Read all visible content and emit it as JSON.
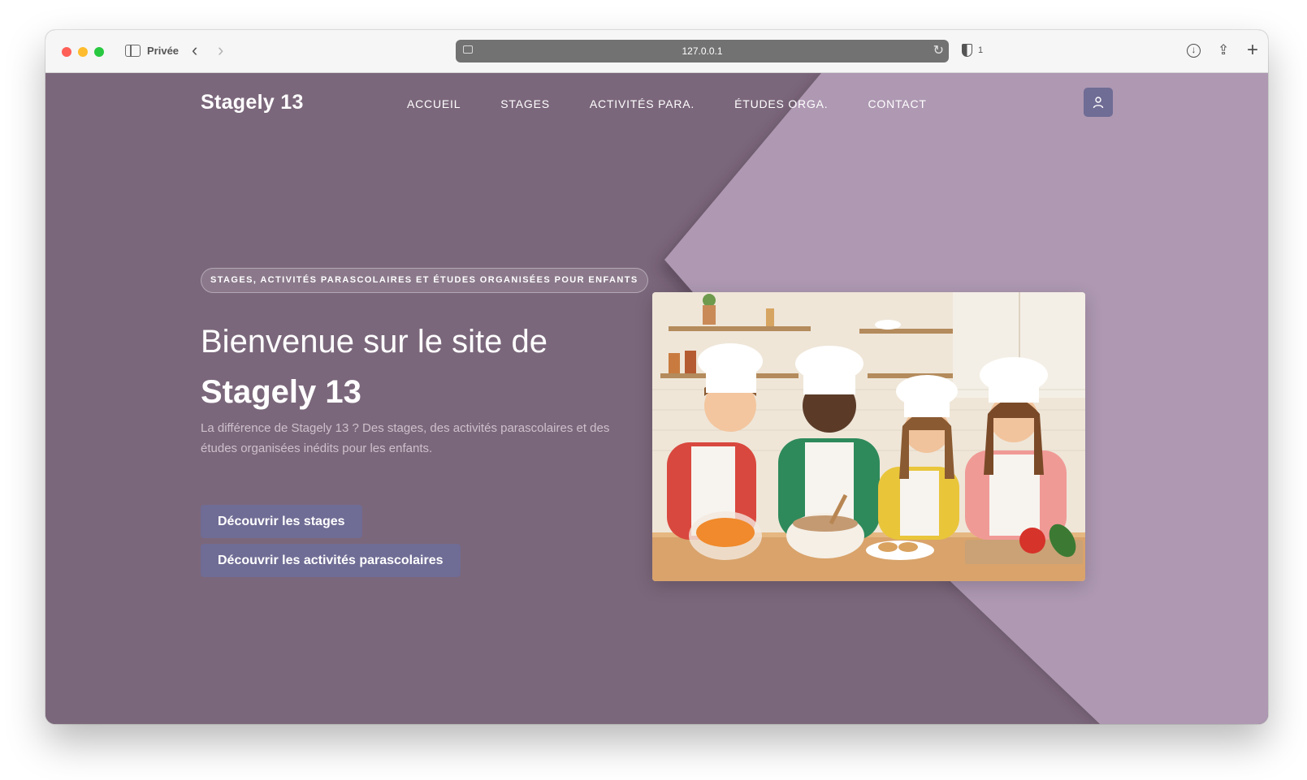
{
  "browser": {
    "private_label": "Privée",
    "url": "127.0.0.1",
    "shield_count": "1"
  },
  "site": {
    "brand": "Stagely 13",
    "nav": [
      "ACCUEIL",
      "STAGES",
      "ACTIVITÉS PARA.",
      "ÉTUDES ORGA.",
      "CONTACT"
    ]
  },
  "hero": {
    "badge": "STAGES, ACTIVITÉS PARASCOLAIRES ET ÉTUDES ORGANISÉES POUR ENFANTS",
    "title_line1": "Bienvenue sur le site de",
    "title_line2": "Stagely 13",
    "description": "La différence de Stagely 13 ? Des stages, des activités parascolaires et des études organisées inédits pour les enfants.",
    "button_primary": "Découvrir les stages",
    "button_secondary": "Découvrir les activités parascolaires"
  },
  "colors": {
    "page_bg": "#7b677b",
    "accent_panel": "#ae98b2",
    "button": "#6f6c95"
  }
}
